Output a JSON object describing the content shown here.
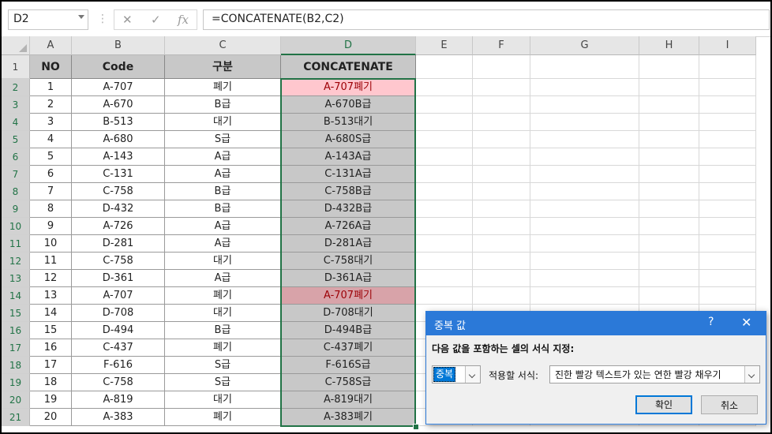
{
  "formula_bar": {
    "name_box": "D2",
    "separator": "⋮",
    "cancel_glyph": "✕",
    "enter_glyph": "✓",
    "fx_glyph": "fx",
    "formula": "=CONCATENATE(B2,C2)"
  },
  "columns": [
    "A",
    "B",
    "C",
    "D",
    "E",
    "F",
    "G",
    "H",
    "I"
  ],
  "rows": [
    "1",
    "2",
    "3",
    "4",
    "5",
    "6",
    "7",
    "8",
    "9",
    "10",
    "11",
    "12",
    "13",
    "14",
    "15",
    "16",
    "17",
    "18",
    "19",
    "20",
    "21"
  ],
  "table": {
    "headers": [
      "NO",
      "Code",
      "구분",
      "CONCATENATE"
    ],
    "rows": [
      [
        "1",
        "A-707",
        "폐기",
        "A-707폐기"
      ],
      [
        "2",
        "A-670",
        "B급",
        "A-670B급"
      ],
      [
        "3",
        "B-513",
        "대기",
        "B-513대기"
      ],
      [
        "4",
        "A-680",
        "S급",
        "A-680S급"
      ],
      [
        "5",
        "A-143",
        "A급",
        "A-143A급"
      ],
      [
        "6",
        "C-131",
        "A급",
        "C-131A급"
      ],
      [
        "7",
        "C-758",
        "B급",
        "C-758B급"
      ],
      [
        "8",
        "D-432",
        "B급",
        "D-432B급"
      ],
      [
        "9",
        "A-726",
        "A급",
        "A-726A급"
      ],
      [
        "10",
        "D-281",
        "A급",
        "D-281A급"
      ],
      [
        "11",
        "C-758",
        "대기",
        "C-758대기"
      ],
      [
        "12",
        "D-361",
        "A급",
        "D-361A급"
      ],
      [
        "13",
        "A-707",
        "폐기",
        "A-707폐기"
      ],
      [
        "14",
        "D-708",
        "대기",
        "D-708대기"
      ],
      [
        "15",
        "D-494",
        "B급",
        "D-494B급"
      ],
      [
        "16",
        "C-437",
        "폐기",
        "C-437폐기"
      ],
      [
        "17",
        "F-616",
        "S급",
        "F-616S급"
      ],
      [
        "18",
        "C-758",
        "S급",
        "C-758S급"
      ],
      [
        "19",
        "A-819",
        "대기",
        "A-819대기"
      ],
      [
        "20",
        "A-383",
        "폐기",
        "A-383폐기"
      ]
    ],
    "duplicate_fill": "#ffc7ce",
    "duplicate_text": "#9c0006"
  },
  "dialog": {
    "title": "중복 값",
    "help": "?",
    "close": "✕",
    "prompt": "다음 값을 포함하는 셀의 서식 지정:",
    "rule_type": "중복",
    "apply_label": "적용할 서식:",
    "format_value": "진한 빨강 텍스트가 있는 연한 빨강 채우기",
    "ok_label": "확인",
    "cancel_label": "취소"
  },
  "colors": {
    "accent": "#217346",
    "dialog_title": "#2b79d8",
    "header_fill": "#c8c8c8"
  }
}
